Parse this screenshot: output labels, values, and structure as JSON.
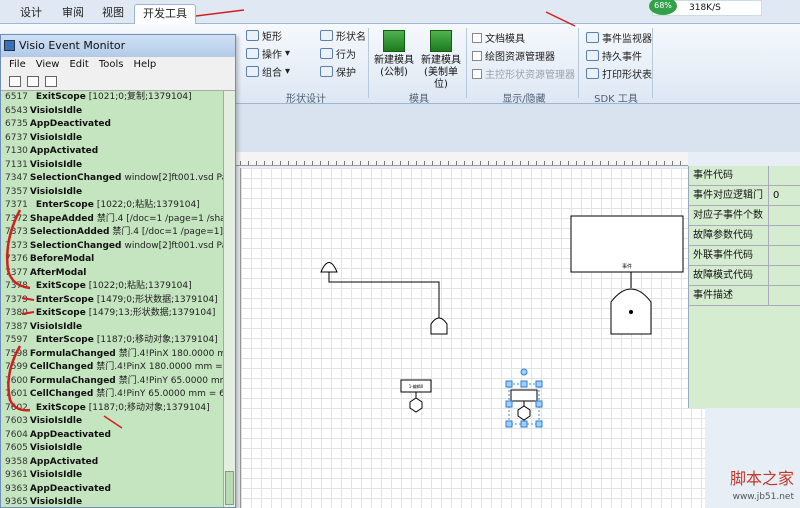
{
  "ribbon": {
    "tabs": [
      "设计",
      "审阅",
      "视图",
      "开发工具"
    ],
    "active_tab": "开发工具",
    "shape_design": {
      "items": [
        "矩形",
        "操作",
        "组合",
        "形状名",
        "行为",
        "保护"
      ],
      "group": "形状设计"
    },
    "templates": {
      "new_metric": "新建模具\n(公制)",
      "new_us": "新建模具\n(美制单位)",
      "group": "模具"
    },
    "show_hide": {
      "items": [
        "文档模具",
        "绘图资源管理器",
        "主控形状资源管理器"
      ],
      "group": "显示/隐藏"
    },
    "sdk": {
      "items": [
        "事件监视器",
        "持久事件",
        "打印形状表"
      ],
      "group": "SDK 工具"
    },
    "net": {
      "percent": "68%",
      "speed": "318K/S"
    }
  },
  "monitor": {
    "title": "Visio Event Monitor",
    "menu": [
      "File",
      "View",
      "Edit",
      "Tools",
      "Help"
    ],
    "events": [
      {
        "n": "6517",
        "e": "ExitScope",
        "d": "[1021;0;复制;1379104]"
      },
      {
        "n": "6543",
        "e": "VisioIsIdle",
        "d": ""
      },
      {
        "n": "6735",
        "e": "AppDeactivated",
        "d": ""
      },
      {
        "n": "6737",
        "e": "VisioIsIdle",
        "d": ""
      },
      {
        "n": "7130",
        "e": "AppActivated",
        "d": ""
      },
      {
        "n": "7131",
        "e": "VisioIsIdle",
        "d": ""
      },
      {
        "n": "7347",
        "e": "SelectionChanged",
        "d": "window[2]ft001.vsd Page-1"
      },
      {
        "n": "7357",
        "e": "VisioIsIdle",
        "d": ""
      },
      {
        "n": "7371",
        "e": "EnterScope",
        "d": "[1022;0;粘贴;1379104]"
      },
      {
        "n": "7372",
        "e": "ShapeAdded",
        "d": "禁门.4 [/doc=1 /page=1 /shape"
      },
      {
        "n": "7373",
        "e": "SelectionAdded",
        "d": "禁门.4 [/doc=1 /page=1]"
      },
      {
        "n": "7373",
        "e": "SelectionChanged",
        "d": "window[2]ft001.vsd Page"
      },
      {
        "n": "7376",
        "e": "BeforeModal",
        "d": ""
      },
      {
        "n": "7377",
        "e": "AfterModal",
        "d": ""
      },
      {
        "n": "7378",
        "e": "ExitScope",
        "d": "[1022;0;粘贴;1379104]"
      },
      {
        "n": "7379",
        "e": "EnterScope",
        "d": "[1479;0;形状数据;1379104]"
      },
      {
        "n": "7380",
        "e": "ExitScope",
        "d": "[1479;13;形状数据;1379104]"
      },
      {
        "n": "7387",
        "e": "VisioIsIdle",
        "d": ""
      },
      {
        "n": "7597",
        "e": "EnterScope",
        "d": "[1187;0;移动对象;1379104]"
      },
      {
        "n": "7598",
        "e": "FormulaChanged",
        "d": "禁门.4!PinX 180.0000 mm +"
      },
      {
        "n": "7599",
        "e": "CellChanged",
        "d": "禁门.4!PinX 180.0000 mm = 180"
      },
      {
        "n": "7600",
        "e": "FormulaChanged",
        "d": "禁门.4!PinY 65.0000 mm + 0"
      },
      {
        "n": "7601",
        "e": "CellChanged",
        "d": "禁门.4!PinY 65.0000 mm = 65 mm"
      },
      {
        "n": "7602",
        "e": "ExitScope",
        "d": "[1187;0;移动对象;1379104]"
      },
      {
        "n": "7603",
        "e": "VisioIsIdle",
        "d": ""
      },
      {
        "n": "7604",
        "e": "AppDeactivated",
        "d": ""
      },
      {
        "n": "7605",
        "e": "VisioIsIdle",
        "d": ""
      },
      {
        "n": "9358",
        "e": "AppActivated",
        "d": ""
      },
      {
        "n": "9361",
        "e": "VisioIsIdle",
        "d": ""
      },
      {
        "n": "9363",
        "e": "AppDeactivated",
        "d": ""
      },
      {
        "n": "9365",
        "e": "VisioIsIdle",
        "d": ""
      }
    ]
  },
  "properties": [
    {
      "k": "事件代码",
      "v": ""
    },
    {
      "k": "事件对应逻辑门",
      "v": "0"
    },
    {
      "k": "对应子事件个数",
      "v": ""
    },
    {
      "k": "故障参数代码",
      "v": ""
    },
    {
      "k": "外联事件代码",
      "v": ""
    },
    {
      "k": "故障模式代码",
      "v": ""
    },
    {
      "k": "事件描述",
      "v": ""
    }
  ],
  "diagram": {
    "box_label": "事件",
    "small_label": "1-编辑0"
  },
  "watermark": {
    "main": "脚本之家",
    "url": "www.jb51.net"
  }
}
